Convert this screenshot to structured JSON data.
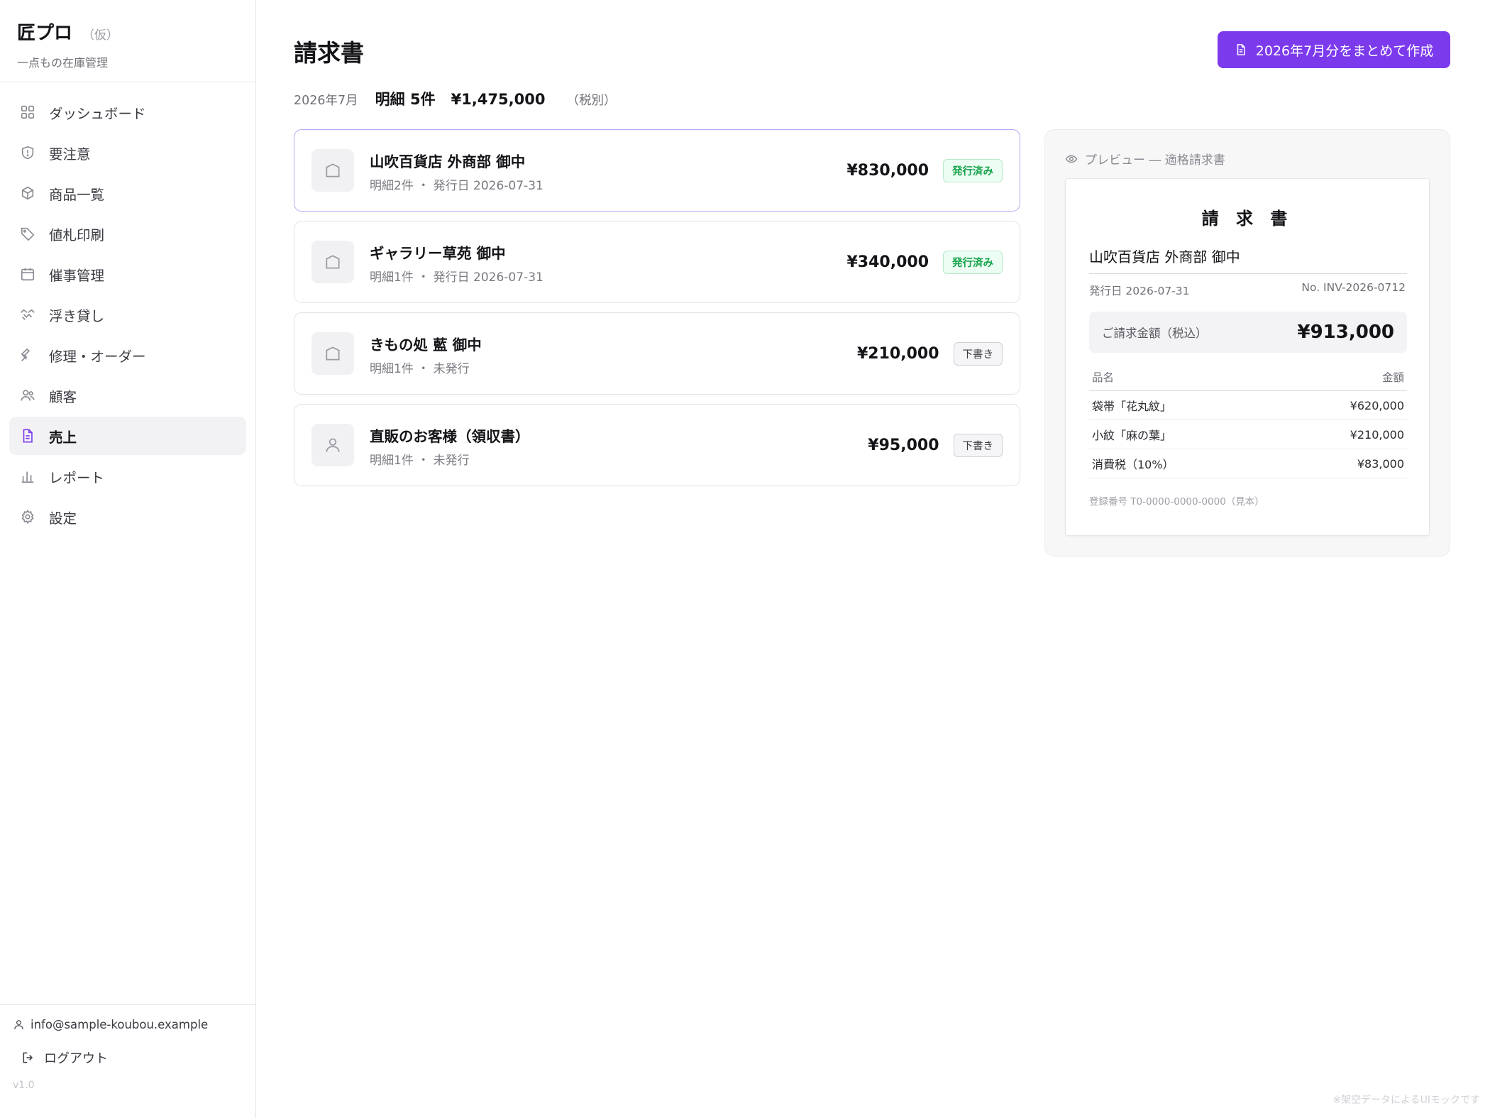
{
  "brand": {
    "name": "匠プロ",
    "tag": "（仮）",
    "subtitle": "一点もの在庫管理"
  },
  "sidebar": {
    "items": [
      {
        "label": "ダッシュボード",
        "icon": "grid-icon"
      },
      {
        "label": "要注意",
        "icon": "shield-icon"
      },
      {
        "label": "商品一覧",
        "icon": "box-icon"
      },
      {
        "label": "値札印刷",
        "icon": "tag-icon"
      },
      {
        "label": "催事管理",
        "icon": "calendar-icon"
      },
      {
        "label": "浮き貸し",
        "icon": "handshake-icon"
      },
      {
        "label": "修理・オーダー",
        "icon": "wrench-icon"
      },
      {
        "label": "顧客",
        "icon": "users-icon"
      },
      {
        "label": "売上",
        "icon": "document-icon",
        "active": true
      },
      {
        "label": "レポート",
        "icon": "bar-chart-icon"
      },
      {
        "label": "設定",
        "icon": "gear-icon"
      }
    ]
  },
  "account": {
    "email": "info@sample-koubou.example",
    "logout_label": "ログアウト",
    "version": "v1.0"
  },
  "header": {
    "title": "請求書",
    "action_label": "2026年7月分をまとめて作成"
  },
  "summary": {
    "month": "2026年7月",
    "count": "明細 5件",
    "total": "¥1,475,000",
    "tax_note": "（税別）"
  },
  "invoices": [
    {
      "name": "山吹百貨店 外商部 御中",
      "meta": "明細2件 ・ 発行日 2026-07-31",
      "amount": "¥830,000",
      "status": "発行済み",
      "icon": "building-icon"
    },
    {
      "name": "ギャラリー草苑 御中",
      "meta": "明細1件 ・ 発行日 2026-07-31",
      "amount": "¥340,000",
      "status": "発行済み",
      "icon": "building-icon"
    },
    {
      "name": "きもの処 藍 御中",
      "meta": "明細1件 ・ 未発行",
      "amount": "¥210,000",
      "status": "下書き",
      "icon": "building-icon"
    },
    {
      "name": "直販のお客様（領収書）",
      "meta": "明細1件 ・ 未発行",
      "amount": "¥95,000",
      "status": "下書き",
      "icon": "person-icon"
    }
  ],
  "preview": {
    "label": "プレビュー ― 適格請求書",
    "title": "請 求 書",
    "recipient": "山吹百貨店 外商部 御中",
    "issue_date": "発行日 2026-07-31",
    "number": "No. INV-2026-0712",
    "total_label": "ご請求金額（税込）",
    "total_value": "¥913,000",
    "col_item": "品名",
    "col_amount": "金額",
    "lines": [
      {
        "item": "袋帯「花丸紋」",
        "amount": "¥620,000"
      },
      {
        "item": "小紋「麻の葉」",
        "amount": "¥210,000"
      },
      {
        "item": "消費税（10%）",
        "amount": "¥83,000"
      }
    ],
    "registration": "登録番号 T0-0000-0000-0000（見本）"
  },
  "footnote": "※架空データによるUIモックです",
  "colors": {
    "accent": "#7c3aed",
    "issued": "#16a34a",
    "border": "#e3e3e8"
  }
}
